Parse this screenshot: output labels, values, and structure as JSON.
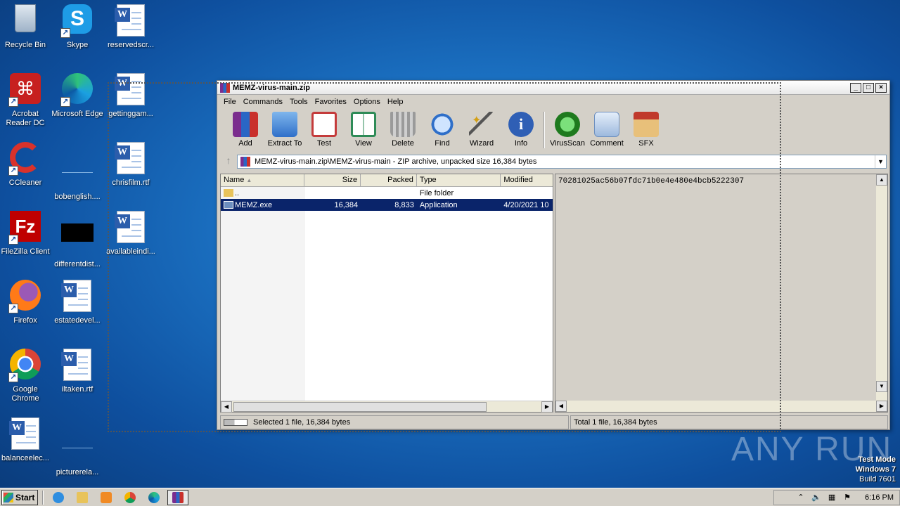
{
  "desktop": {
    "icons": [
      {
        "label": "Recycle Bin"
      },
      {
        "label": "Skype"
      },
      {
        "label": "reservedscr..."
      },
      {
        "label": "Acrobat Reader DC"
      },
      {
        "label": "Microsoft Edge"
      },
      {
        "label": "gettinggam..."
      },
      {
        "label": "CCleaner"
      },
      {
        "label": "bobenglish...."
      },
      {
        "label": "chrisfilm.rtf"
      },
      {
        "label": "FileZilla Client"
      },
      {
        "label": "differentdist..."
      },
      {
        "label": "availableindi..."
      },
      {
        "label": "Firefox"
      },
      {
        "label": "estatedevel..."
      },
      {
        "label": "Google Chrome"
      },
      {
        "label": "iltaken.rtf"
      },
      {
        "label": "balanceelec..."
      },
      {
        "label": "picturerela..."
      }
    ]
  },
  "window": {
    "title": "MEMZ-virus-main.zip",
    "controls": {
      "minimize": "_",
      "maximize": "□",
      "close": "×"
    },
    "menu": [
      "File",
      "Commands",
      "Tools",
      "Favorites",
      "Options",
      "Help"
    ],
    "toolbar": [
      {
        "label": "Add",
        "icon": "add-archive-icon",
        "color": "#b0403a"
      },
      {
        "label": "Extract To",
        "icon": "folder-extract-icon",
        "color": "#3a7bd5"
      },
      {
        "label": "Test",
        "icon": "test-checklist-icon",
        "color": "#c43b3b"
      },
      {
        "label": "View",
        "icon": "book-view-icon",
        "color": "#2e8b57"
      },
      {
        "label": "Delete",
        "icon": "trash-icon",
        "color": "#8a8a8a"
      },
      {
        "label": "Find",
        "icon": "magnifier-icon",
        "color": "#2f6fc9"
      },
      {
        "label": "Wizard",
        "icon": "wand-icon",
        "color": "#d4a017"
      },
      {
        "label": "Info",
        "icon": "info-icon",
        "color": "#2f5fb5"
      },
      {
        "label": "VirusScan",
        "icon": "virus-scan-icon",
        "color": "#2a9b2a"
      },
      {
        "label": "Comment",
        "icon": "comment-icon",
        "color": "#7fa7d8"
      },
      {
        "label": "SFX",
        "icon": "sfx-box-icon",
        "color": "#c0392b"
      }
    ],
    "address": "MEMZ-virus-main.zip\\MEMZ-virus-main - ZIP archive, unpacked size 16,384 bytes",
    "columns": {
      "name": "Name",
      "size": "Size",
      "packed": "Packed",
      "type": "Type",
      "modified": "Modified"
    },
    "files": [
      {
        "name": "..",
        "size": "",
        "packed": "",
        "type": "File folder",
        "modified": ""
      },
      {
        "name": "MEMZ.exe",
        "size": "16,384",
        "packed": "8,833",
        "type": "Application",
        "modified": "4/20/2021 10"
      }
    ],
    "info_text": "70281025ac56b07fdc71b0e4e480e4bcb5222307",
    "status_left": "Selected 1 file, 16,384 bytes",
    "status_right": "Total 1 file, 16,384 bytes"
  },
  "watermark": "ANY RUN",
  "test_mode": {
    "line1": "Test Mode",
    "line2": "Windows 7",
    "line3": "Build 7601"
  },
  "taskbar": {
    "start_label": "Start",
    "clock": "6:16 PM"
  }
}
